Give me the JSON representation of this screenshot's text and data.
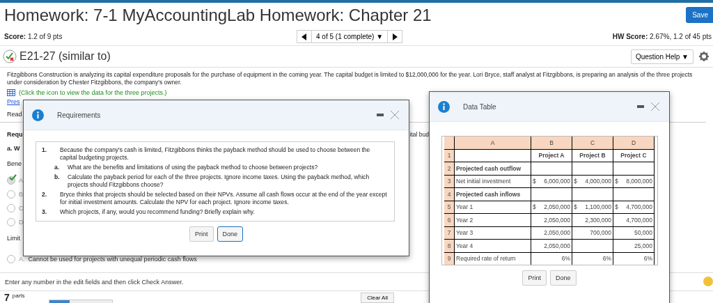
{
  "header": {
    "title": "Homework: 7-1 MyAccountingLab Homework: Chapter 21",
    "save_button": "Save"
  },
  "score_bar": {
    "score": "**Score:** 1.2 of 9 pts",
    "nav_text": "4 of 5 (1 complete) ▼",
    "hw_score": "**HW Score:** 2.67%, 1.2 of 45 pts"
  },
  "question": {
    "title": "E21-27 (similar to)",
    "help_button": "Question Help ▼"
  },
  "intro": "Fitzgibbons Construction is analyzing its capital expenditure proposals for the purchase of equipment in the coming year. The capital budget is limited to $12,000,000 for the year. Lori Bryce, staff analyst at Fitzgibbons, is preparing an analysis of the three projects under consideration by Chester Fitzgibbons, the company's owner.",
  "data_link": "(Click the icon to view the data for the three projects.)",
  "background": {
    "link": "Pres",
    "read": "Read",
    "heading": "Requ",
    "right_fragment": "ital bud",
    "question_a": "a. W",
    "benefits_label": "Bene",
    "options": [
      {
        "letter": "A",
        "selected": true
      },
      {
        "letter": "B",
        "selected": false
      },
      {
        "letter": "C",
        "selected": false
      },
      {
        "letter": "D",
        "selected": false
      }
    ],
    "limitations_label": "Limit",
    "limitation_options": [
      {
        "letter": "A.",
        "text": "Cannot be used for projects with unequal periodic cash flows",
        "selected": false
      }
    ]
  },
  "instruction": "Enter any number in the edit fields and then click Check Answer.",
  "footer": {
    "parts_count": "7",
    "parts_label": "parts",
    "level": 0.33,
    "clear_button": "Clear All"
  },
  "requirements_modal": {
    "title": "Requirements",
    "items": [
      {
        "number": "1.",
        "text": "Because the company's cash is limited, Fitzgibbons thinks the payback method should be used to choose between the capital budgeting projects.",
        "children": [
          {
            "number": "a.",
            "text": "What are the benefits and limitations of using the payback method to choose between projects?"
          },
          {
            "number": "b.",
            "text": "Calculate the payback period for each of the three projects. Ignore income taxes. Using the payback method, which projects should Fitzgibbons choose?"
          }
        ]
      },
      {
        "number": "2.",
        "text": "Bryce thinks that projects should be selected based on their NPVs. Assume all cash flows occur at the end of the year except for initial investment amounts. Calculate the NPV for each project. Ignore income taxes."
      },
      {
        "number": "3.",
        "text": "Which projects, if any, would you recommend funding? Briefly explain why."
      }
    ],
    "buttons": [
      {
        "label": "Print",
        "selected": false
      },
      {
        "label": "Done",
        "selected": true
      }
    ]
  },
  "data_modal": {
    "title": "Data Table",
    "columns": [
      "A",
      "B",
      "C",
      "D"
    ],
    "rows": [
      {
        "number": "1",
        "kind": "heading",
        "cells": [
          null,
          {
            "value": "Project A"
          },
          {
            "value": "Project B"
          },
          {
            "value": "Project C"
          }
        ]
      },
      {
        "number": "2",
        "kind": "section",
        "cells": [
          {
            "value": "Projected cash outflow"
          },
          null,
          null,
          null
        ]
      },
      {
        "number": "3",
        "kind": "value",
        "cells": [
          {
            "value": "Net initial investment"
          },
          {
            "prefix": "$",
            "value": "6,000,000"
          },
          {
            "prefix": "$",
            "value": "4,000,000"
          },
          {
            "prefix": "$",
            "value": "8,000,000"
          }
        ]
      },
      {
        "number": "4",
        "kind": "section",
        "cells": [
          {
            "value": "Projected cash inflows"
          },
          null,
          null,
          null
        ]
      },
      {
        "number": "5",
        "kind": "value",
        "cells": [
          {
            "value": "Year 1"
          },
          {
            "prefix": "$",
            "value": "2,050,000"
          },
          {
            "prefix": "$",
            "value": "1,100,000"
          },
          {
            "prefix": "$",
            "value": "4,700,000"
          }
        ]
      },
      {
        "number": "6",
        "kind": "value",
        "cells": [
          {
            "value": "Year 2"
          },
          {
            "value": "2,050,000"
          },
          {
            "value": "2,300,000"
          },
          {
            "value": "4,700,000"
          }
        ]
      },
      {
        "number": "7",
        "kind": "value",
        "cells": [
          {
            "value": "Year 3"
          },
          {
            "value": "2,050,000"
          },
          {
            "value": "700,000"
          },
          {
            "value": "50,000"
          }
        ]
      },
      {
        "number": "8",
        "kind": "value",
        "cells": [
          {
            "value": "Year 4"
          },
          {
            "value": "2,050,000"
          },
          null,
          {
            "value": "25,000"
          }
        ]
      },
      {
        "number": "9",
        "kind": "value",
        "cells": [
          {
            "value": "Required rate of return"
          },
          {
            "value": "6%"
          },
          {
            "value": "6%"
          },
          {
            "value": "6%"
          }
        ]
      }
    ],
    "buttons": [
      {
        "label": "Print",
        "selected": false
      },
      {
        "label": "Done",
        "selected": false
      }
    ]
  }
}
